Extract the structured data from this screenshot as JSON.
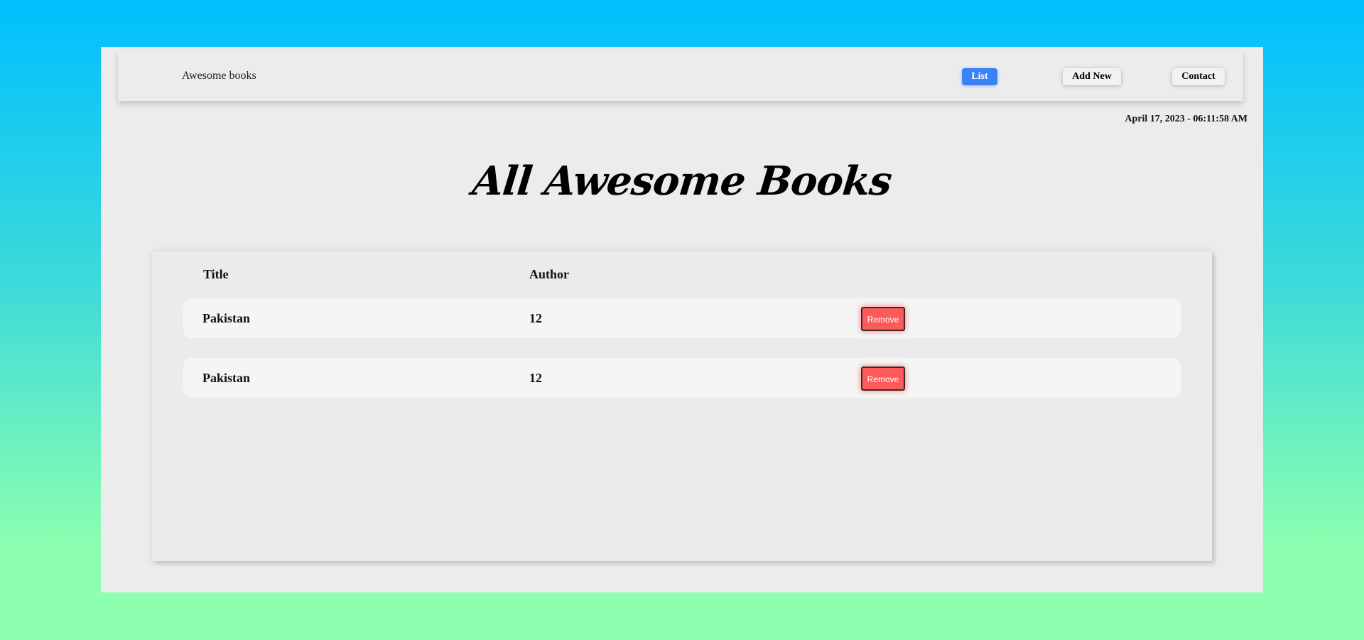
{
  "navbar": {
    "brand": "Awesome books",
    "links": [
      {
        "label": "List",
        "active": true
      },
      {
        "label": "Add New",
        "active": false
      },
      {
        "label": "Contact",
        "active": false
      }
    ]
  },
  "datetime": "April 17, 2023 - 06:11:58 AM",
  "page_title": "All Awesome Books",
  "table": {
    "headers": [
      "Title",
      "Author"
    ],
    "rows": [
      {
        "title": "Pakistan",
        "author": "12",
        "action": "Remove"
      },
      {
        "title": "Pakistan",
        "author": "12",
        "action": "Remove"
      }
    ]
  },
  "colors": {
    "active_link": "#3b82f6",
    "remove_button": "#ff5a5a",
    "background_top": "#00bfff",
    "background_bottom": "#8effb2"
  }
}
